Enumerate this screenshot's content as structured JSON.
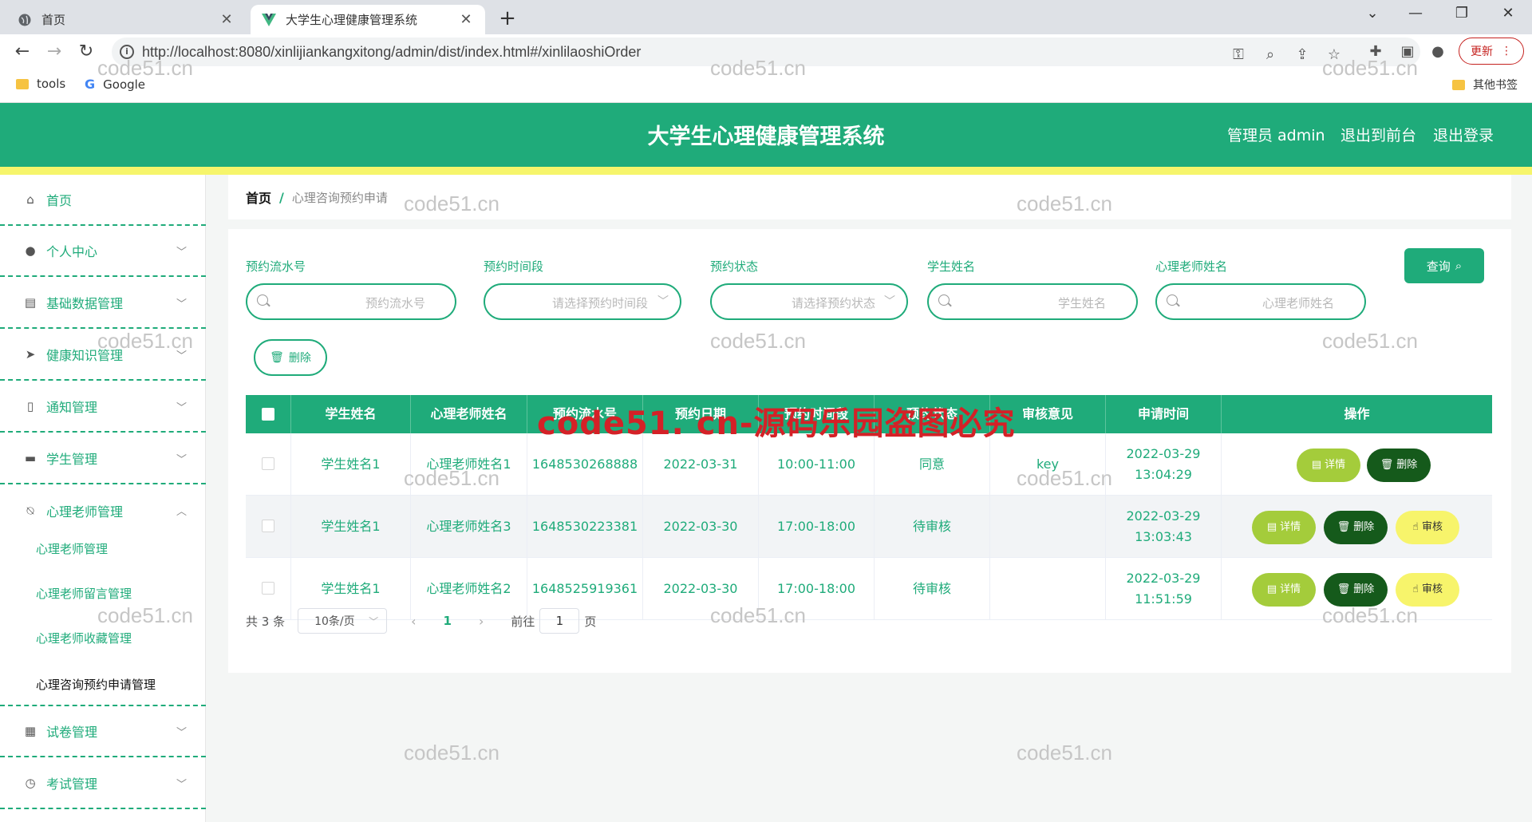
{
  "browser": {
    "tabs": [
      {
        "title": "首页",
        "close": "✕"
      },
      {
        "title": "大学生心理健康管理系统",
        "close": "✕"
      }
    ],
    "new_tab": "+",
    "url": "http://localhost:8080/xinlijiankangxitong/admin/dist/index.html#/xinlilaoshiOrder",
    "update_label": "更新",
    "bookmarks": [
      {
        "label": "tools"
      },
      {
        "label": "Google"
      }
    ],
    "other_bookmarks": "其他书签"
  },
  "header": {
    "title": "大学生心理健康管理系统",
    "user": "管理员 admin",
    "to_front": "退出到前台",
    "logout": "退出登录"
  },
  "sidebar": {
    "items": [
      {
        "label": "首页",
        "icon": "home-icon"
      },
      {
        "label": "个人中心",
        "icon": "user-icon"
      },
      {
        "label": "基础数据管理",
        "icon": "clipboard-icon"
      },
      {
        "label": "健康知识管理",
        "icon": "send-icon"
      },
      {
        "label": "通知管理",
        "icon": "phone-icon"
      },
      {
        "label": "学生管理",
        "icon": "sign-icon"
      },
      {
        "label": "心理老师管理",
        "icon": "bell-off-icon"
      },
      {
        "label": "试卷管理",
        "icon": "document-icon"
      },
      {
        "label": "考试管理",
        "icon": "clock-icon"
      }
    ],
    "subitems": [
      {
        "label": "心理老师管理"
      },
      {
        "label": "心理老师留言管理"
      },
      {
        "label": "心理老师收藏管理"
      },
      {
        "label": "心理咨询预约申请管理"
      }
    ]
  },
  "breadcrumb": {
    "home": "首页",
    "sep": "/",
    "current": "心理咨询预约申请"
  },
  "search": {
    "fields": [
      {
        "label": "预约流水号",
        "placeholder": "预约流水号"
      },
      {
        "label": "预约时间段",
        "placeholder": "请选择预约时间段"
      },
      {
        "label": "预约状态",
        "placeholder": "请选择预约状态"
      },
      {
        "label": "学生姓名",
        "placeholder": "学生姓名"
      },
      {
        "label": "心理老师姓名",
        "placeholder": "心理老师姓名"
      }
    ],
    "query_label": "查询",
    "delete_label": "删除"
  },
  "table": {
    "headers": [
      "学生姓名",
      "心理老师姓名",
      "预约流水号",
      "预约日期",
      "预约时间段",
      "预约状态",
      "审核意见",
      "申请时间",
      "操作"
    ],
    "rows": [
      {
        "student": "学生姓名1",
        "teacher": "心理老师姓名1",
        "serial": "1648530268888",
        "date": "2022-03-31",
        "slot": "10:00-11:00",
        "status": "同意",
        "opinion": "key",
        "applied": "2022-03-29 13:04:29"
      },
      {
        "student": "学生姓名1",
        "teacher": "心理老师姓名3",
        "serial": "1648530223381",
        "date": "2022-03-30",
        "slot": "17:00-18:00",
        "status": "待审核",
        "opinion": "",
        "applied": "2022-03-29 13:03:43"
      },
      {
        "student": "学生姓名1",
        "teacher": "心理老师姓名2",
        "serial": "1648525919361",
        "date": "2022-03-30",
        "slot": "17:00-18:00",
        "status": "待审核",
        "opinion": "",
        "applied": "2022-03-29 11:51:59"
      }
    ],
    "actions": {
      "detail": "详情",
      "delete": "删除",
      "audit": "审核"
    }
  },
  "pager": {
    "total": "共 3 条",
    "page_size": "10条/页",
    "current_page": "1",
    "goto_prefix": "前往",
    "goto_value": "1",
    "goto_suffix": "页"
  },
  "watermarks": {
    "site": "code51.cn",
    "banner": "code51. cn-源码乐园盗图必究"
  },
  "colors": {
    "primary": "#1fab7a",
    "accent_yellow": "#f6f56b",
    "detail_btn": "#a4cc3b",
    "delete_btn": "#155a1b",
    "audit_btn": "#f7f46b",
    "watermark_red": "#d42127"
  }
}
